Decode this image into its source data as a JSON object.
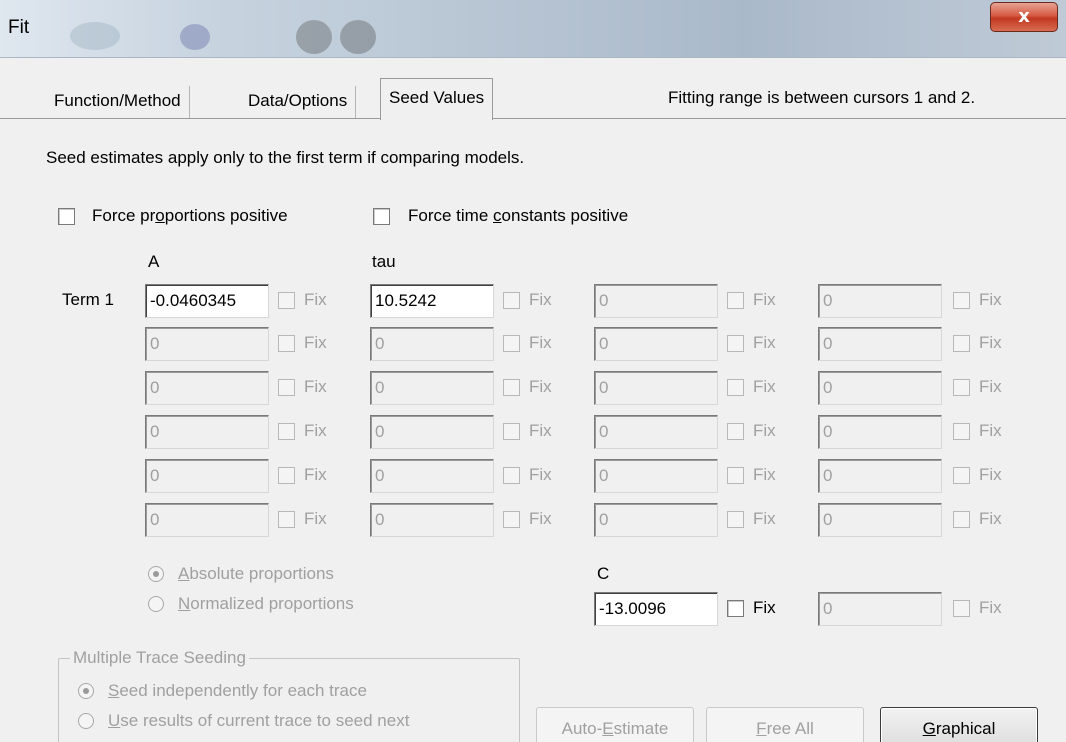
{
  "window": {
    "title": "Fit",
    "close_symbol": "x"
  },
  "tabs": [
    {
      "label": "Function/Method",
      "active": false
    },
    {
      "label": "Data/Options",
      "active": false
    },
    {
      "label": "Seed Values",
      "active": true
    }
  ],
  "fitting_range_note": "Fitting range is between cursors 1 and 2.",
  "seed_note": "Seed estimates apply only to the first term if comparing models.",
  "options": {
    "force_proportions": {
      "label": "Force proportions positive",
      "checked": false
    },
    "force_time_constants": {
      "label": "Force time constants positive",
      "checked": false
    }
  },
  "columns": {
    "a_header": "A",
    "tau_header": "tau",
    "c_header": "C"
  },
  "term_label": "Term 1",
  "fix_label": "Fix",
  "rows": [
    {
      "values": [
        "-0.0460345",
        "10.5242",
        "0",
        "0"
      ]
    },
    {
      "values": [
        "0",
        "0",
        "0",
        "0"
      ]
    },
    {
      "values": [
        "0",
        "0",
        "0",
        "0"
      ]
    },
    {
      "values": [
        "0",
        "0",
        "0",
        "0"
      ]
    },
    {
      "values": [
        "0",
        "0",
        "0",
        "0"
      ]
    },
    {
      "values": [
        "0",
        "0",
        "0",
        "0"
      ]
    }
  ],
  "proportions": {
    "absolute": {
      "label": "Absolute proportions",
      "selected": true
    },
    "normalized": {
      "label": "Normalized proportions",
      "selected": false
    }
  },
  "constant": {
    "value": "-13.0096",
    "extra_value": "0"
  },
  "multiple_trace": {
    "title": "Multiple Trace Seeding",
    "independent": {
      "label": "Seed independently for each trace",
      "selected": true
    },
    "use_results": {
      "label": "Use results of current trace to seed next",
      "selected": false
    }
  },
  "buttons": {
    "auto_estimate": "Auto-Estimate",
    "free_all": "Free All",
    "graphical": "Graphical"
  }
}
